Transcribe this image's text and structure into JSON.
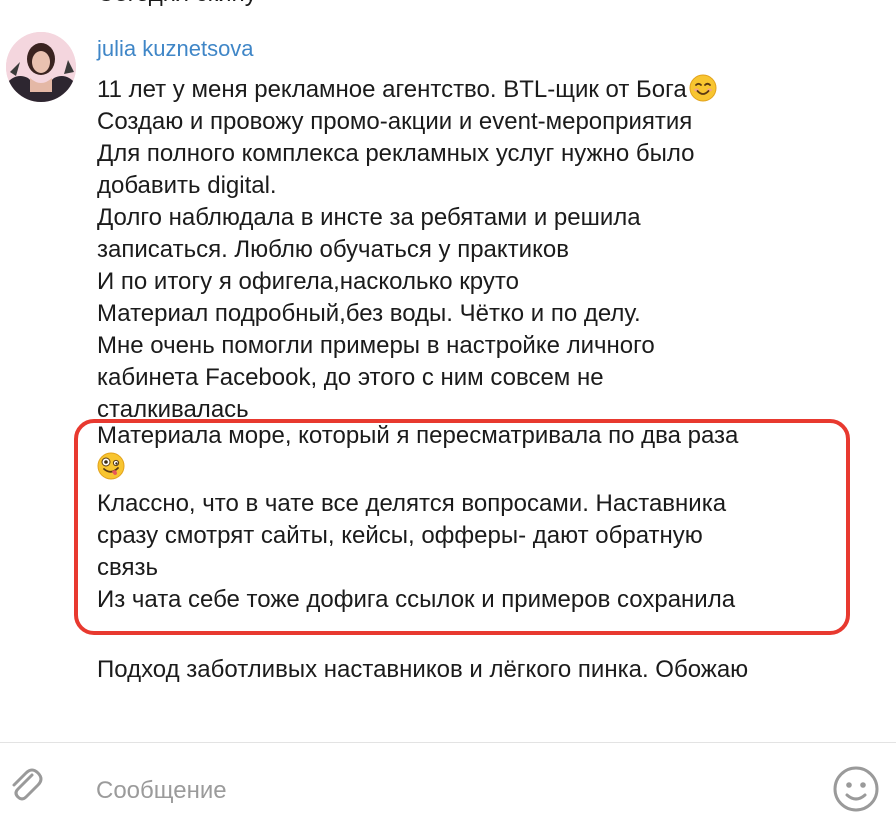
{
  "previous_message": {
    "tail": "Сегодня скину"
  },
  "message": {
    "author": "julia kuznetsova",
    "lines": [
      "11 лет у меня рекламное агентство. BTL-щик от Бога",
      "Создаю и провожу промо-акции и event-мероприятия",
      "Для полного комплекса рекламных услуг нужно было",
      "добавить digital.",
      "Долго наблюдала в инсте за ребятами и решила",
      "записаться. Люблю обучаться у практиков",
      "И по итогу я офигела,насколько круто",
      "Материал подробный,без воды. Чётко и по делу.",
      "Мне очень помогли примеры в настройке личного",
      "кабинета Facebook,  до этого с ним совсем не",
      "сталкивалась",
      "Материала море, который я пересматривала по два раза",
      "Классно, что в чате все делятся вопросами. Наставника",
      "сразу смотрят сайты,  кейсы, офферы- дают обратную",
      "связь",
      "Из чата себе тоже дофига ссылок и примеров сохранила"
    ],
    "last_line": "Подход заботливых наставников и лёгкого пинка. Обожаю",
    "emojis": [
      "smiling-face-emoji",
      "zany-face-emoji"
    ],
    "highlight_color": "#e8392f"
  },
  "composer": {
    "placeholder": "Сообщение",
    "attach_icon": "paperclip-icon",
    "emoji_icon": "smile-icon"
  },
  "colors": {
    "author": "#3f86c7",
    "text": "#1b1b1b",
    "placeholder": "#9b9b9b"
  }
}
